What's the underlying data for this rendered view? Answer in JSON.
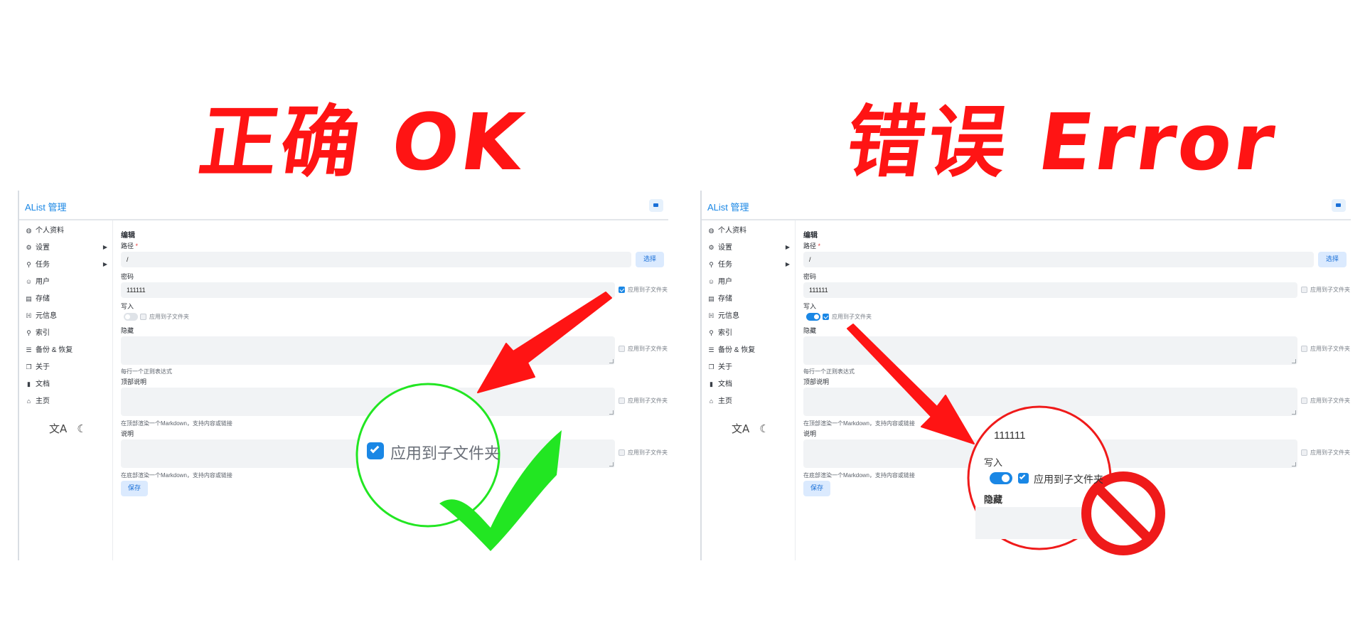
{
  "headlines": {
    "correct": "正确 OK",
    "error": "错误 Error"
  },
  "app": {
    "title": "AList 管理"
  },
  "sidebar": {
    "items": [
      {
        "label": "个人资料",
        "icon": "globe-icon"
      },
      {
        "label": "设置",
        "icon": "gear-icon",
        "arrow": "▶"
      },
      {
        "label": "任务",
        "icon": "route-icon",
        "arrow": "▶"
      },
      {
        "label": "用户",
        "icon": "user-circle-icon"
      },
      {
        "label": "存储",
        "icon": "database-icon"
      },
      {
        "label": "元信息",
        "icon": "meta-icon"
      },
      {
        "label": "索引",
        "icon": "search-icon"
      },
      {
        "label": "备份 & 恢复",
        "icon": "database-stack-icon"
      },
      {
        "label": "关于",
        "icon": "info-icon"
      },
      {
        "label": "文档",
        "icon": "book-icon"
      },
      {
        "label": "主页",
        "icon": "home-icon"
      }
    ],
    "tools": {
      "language_icon": "translate-icon",
      "theme_icon": "moon-icon"
    }
  },
  "form": {
    "heading": "编辑",
    "path_label": "路径",
    "path_required": "*",
    "path_value": "/",
    "select_button": "选择",
    "password_label": "密码",
    "password_value": "111111",
    "write_label": "写入",
    "hide_label": "隐藏",
    "hide_help": "每行一个正则表达式",
    "header_label": "顶部说明",
    "header_help": "在顶部渲染一个Markdown，支持内容或链接",
    "readme_label": "说明",
    "readme_help": "在底部渲染一个Markdown，支持内容或链接",
    "save_button": "保存",
    "apply_sub": "应用到子文件夹"
  },
  "panels": {
    "correct": {
      "password_apply": true,
      "write_toggle": false,
      "write_apply": false
    },
    "error": {
      "password_apply": false,
      "write_toggle": true,
      "write_apply": true
    }
  },
  "magnifier_correct": {
    "apply_sub": "应用到子文件夹"
  },
  "magnifier_error": {
    "password_value": "111111",
    "write_label": "写入",
    "apply_sub": "应用到子文件夹",
    "hide_label": "隐藏"
  },
  "colors": {
    "accent": "#1a87e5",
    "headline_red": "#ff1414",
    "correct_green": "#22e622",
    "error_red": "#ef1a1a"
  }
}
